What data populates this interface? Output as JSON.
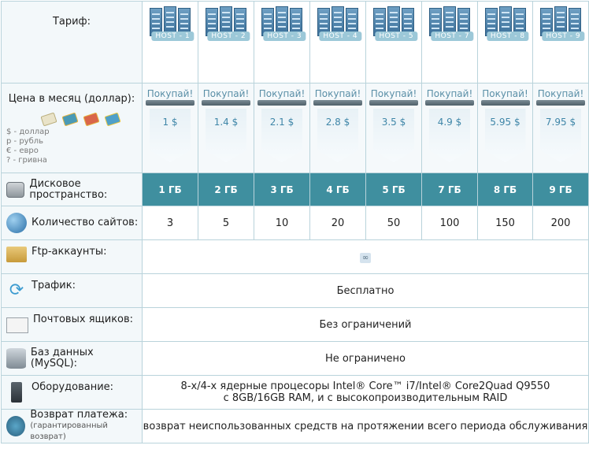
{
  "header": {
    "tariff_label": "Тариф:",
    "hosts": [
      "HOST - 1",
      "HOST - 2",
      "HOST - 3",
      "HOST - 4",
      "HOST - 5",
      "HOST - 7",
      "HOST - 8",
      "HOST - 9"
    ]
  },
  "price_row": {
    "label": "Цена в месяц (доллар):",
    "buy_label": "Покупай!",
    "prices": [
      "1 $",
      "1.4 $",
      "2.1 $",
      "2.8 $",
      "3.5 $",
      "4.9 $",
      "5.95 $",
      "7.95 $"
    ],
    "currency_icons": [
      "coin-dollar-icon",
      "coin-ruble-icon",
      "coin-euro-icon",
      "coin-hryvnia-icon"
    ],
    "legend": [
      "$ - доллар",
      "р - рубль",
      "€ - евро",
      "? - гривна"
    ]
  },
  "disk": {
    "label": "Дисковое пространство:",
    "values": [
      "1 ГБ",
      "2 ГБ",
      "3 ГБ",
      "4 ГБ",
      "5 ГБ",
      "7 ГБ",
      "8 ГБ",
      "9 ГБ"
    ]
  },
  "sites": {
    "label": "Количество сайтов:",
    "values": [
      "3",
      "5",
      "10",
      "20",
      "50",
      "100",
      "150",
      "200"
    ]
  },
  "ftp": {
    "label": "Ftp-аккаунты:",
    "value": "∞"
  },
  "traffic": {
    "label": "Трафик:",
    "value": "Бесплатно"
  },
  "mail": {
    "label": "Почтовых ящиков:",
    "value": "Без ограничений"
  },
  "db": {
    "label": "Баз данных (MySQL):",
    "value": "Не ограничено"
  },
  "hardware": {
    "label": "Оборудование:",
    "line1": "8-х/4-х ядерные процесоры Intel® Core™ i7/Intel® Core2Quad Q9550",
    "line2": "с 8GB/16GB RAM, и с высокопроизводительным RAID"
  },
  "refund": {
    "label": "Возврат платежа:",
    "sublabel": "(гарантированный возврат)",
    "value": "возврат неиспользованных средств на протяжении всего периода обслуживания"
  },
  "colors": {
    "accent": "#3f8f9f",
    "border": "#b9d3db",
    "price_text": "#3f86a8",
    "label_bg": "#f3f8fa"
  }
}
